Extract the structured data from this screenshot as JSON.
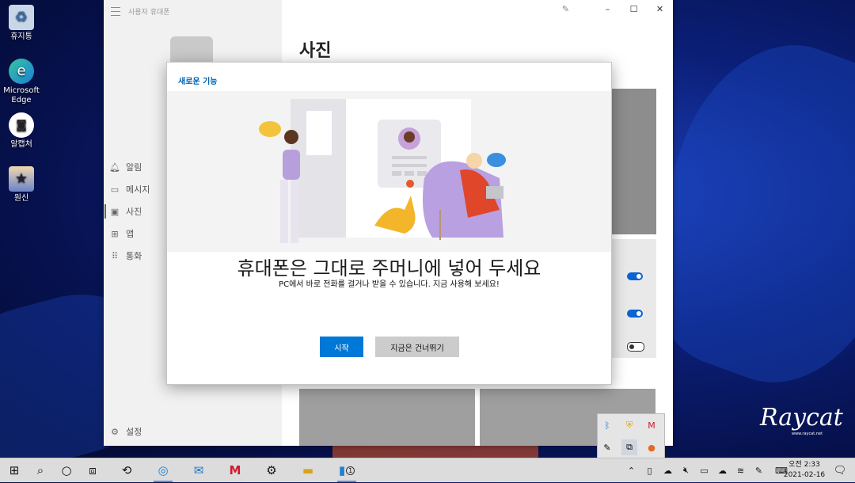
{
  "desktop": {
    "icons": [
      {
        "label": "휴지통",
        "icon": "recycle-bin-icon"
      },
      {
        "label": "Microsoft Edge",
        "icon": "edge-icon"
      },
      {
        "label": "알캡처",
        "icon": "alcapture-icon"
      },
      {
        "label": "원신",
        "icon": "genshin-icon"
      }
    ]
  },
  "app": {
    "title": "사용자 휴대폰",
    "page_title": "사진",
    "nav": [
      {
        "label": "알림",
        "icon": "bell-icon"
      },
      {
        "label": "메시지",
        "icon": "message-icon"
      },
      {
        "label": "사진",
        "icon": "photo-icon",
        "active": true
      },
      {
        "label": "앱",
        "icon": "apps-icon"
      },
      {
        "label": "통화",
        "icon": "dialpad-icon"
      }
    ],
    "settings_label": "설정",
    "toggles": [
      "on",
      "on",
      "off"
    ]
  },
  "dialog": {
    "header": "새로운 기능",
    "title": "휴대폰은 그대로 주머니에 넣어 두세요",
    "subtitle": "PC에서 바로 전화를 걸거나 받을 수 있습니다. 지금 사용해 보세요!",
    "primary_button": "시작",
    "secondary_button": "지금은 건너뛰기"
  },
  "watermark": {
    "text": "Raycat",
    "sub": "www.raycat.net"
  },
  "taskbar": {
    "clock_time": "오전 2:33",
    "clock_date": "2021-02-16",
    "phone_badge": "1"
  },
  "colors": {
    "accent": "#0078d7",
    "link": "#0063b1"
  }
}
